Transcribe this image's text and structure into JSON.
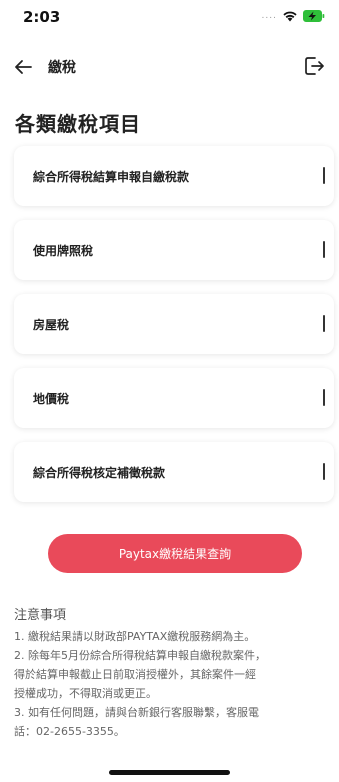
{
  "status_bar": {
    "time": "2:03",
    "signal": "....",
    "wifi_icon": "wifi-icon",
    "battery_icon": "battery-charging-icon",
    "battery_color": "#2fbf3a"
  },
  "nav": {
    "back_icon": "arrow-left-icon",
    "title": "繳稅",
    "logout_icon": "logout-icon"
  },
  "page_title": "各類繳稅項目",
  "tax_items": [
    {
      "label": "綜合所得稅結算申報自繳稅款"
    },
    {
      "label": "使用牌照稅"
    },
    {
      "label": "房屋稅"
    },
    {
      "label": "地價稅"
    },
    {
      "label": "綜合所得稅核定補徵稅款"
    }
  ],
  "query_button": {
    "label": "Paytax繳稅結果查詢",
    "color": "#e94a5a"
  },
  "notes": {
    "title": "注意事項",
    "lines": [
      "1. 繳稅結果請以財政部PAYTAX繳稅服務網為主。",
      "2. 除每年5月份綜合所得稅結算申報自繳稅款案件，",
      "得於結算申報截止日前取消授權外，其餘案件一經",
      "授權成功，不得取消或更正。",
      "3. 如有任何問題，請與台新銀行客服聯繫，客服電",
      "話：02-2655-3355。"
    ]
  }
}
